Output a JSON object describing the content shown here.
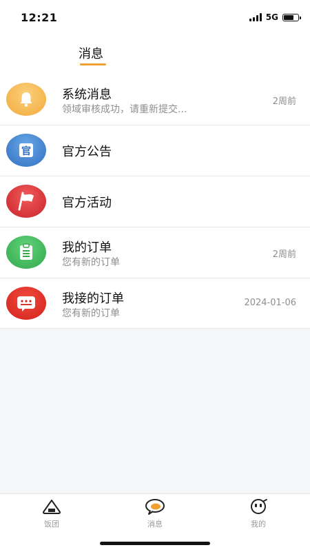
{
  "status_bar": {
    "time": "12:21",
    "network": "5G",
    "battery_level": 0.75
  },
  "header": {
    "title": "消息"
  },
  "messages": [
    {
      "icon": "bell-icon",
      "title": "系统消息",
      "subtitle": "领域审核成功，请重新提交...",
      "time": "2周前",
      "color": "#f4b44a"
    },
    {
      "icon": "official-icon",
      "title": "官方公告",
      "subtitle": "",
      "time": "",
      "color": "#3b82c4"
    },
    {
      "icon": "flag-icon",
      "title": "官方活动",
      "subtitle": "",
      "time": "",
      "color": "#e2363a"
    },
    {
      "icon": "clipboard-icon",
      "title": "我的订单",
      "subtitle": "您有新的订单",
      "time": "2周前",
      "color": "#41b85a"
    },
    {
      "icon": "chat-icon",
      "title": "我接的订单",
      "subtitle": "您有新的订单",
      "time": "2024-01-06",
      "color": "#e2332b"
    }
  ],
  "bottom_nav": [
    {
      "icon": "rice-ball-icon",
      "label": "饭团"
    },
    {
      "icon": "message-bubble-icon",
      "label": "消息",
      "active": true
    },
    {
      "icon": "profile-face-icon",
      "label": "我的"
    }
  ],
  "colors": {
    "accent": "#f0a030",
    "background": "#f5f6f8"
  }
}
